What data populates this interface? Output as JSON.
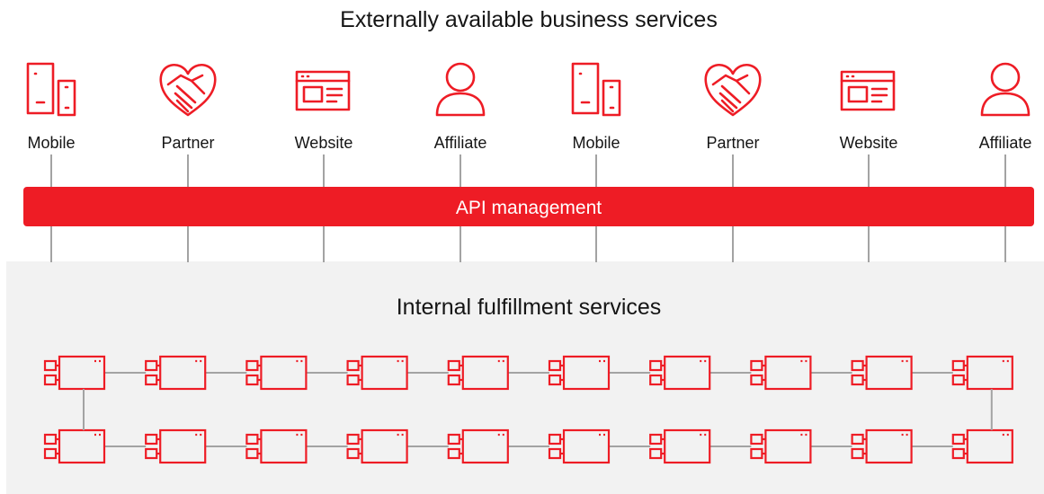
{
  "title": "Externally available business services",
  "channels": [
    {
      "label": "Mobile",
      "icon": "mobile-devices-icon"
    },
    {
      "label": "Partner",
      "icon": "handshake-heart-icon"
    },
    {
      "label": "Website",
      "icon": "website-icon"
    },
    {
      "label": "Affiliate",
      "icon": "person-icon"
    },
    {
      "label": "Mobile",
      "icon": "mobile-devices-icon"
    },
    {
      "label": "Partner",
      "icon": "handshake-heart-icon"
    },
    {
      "label": "Website",
      "icon": "website-icon"
    },
    {
      "label": "Affiliate",
      "icon": "person-icon"
    }
  ],
  "api_bar_label": "API management",
  "internal_title": "Internal fulfillment services",
  "service_rows": 2,
  "services_per_row": 10,
  "service_icon": "service-component-icon",
  "colors": {
    "accent": "#ee1c25",
    "panel": "#f2f2f2",
    "connector": "#a3a3a3",
    "text": "#151515",
    "bar_text": "#ffffff"
  }
}
